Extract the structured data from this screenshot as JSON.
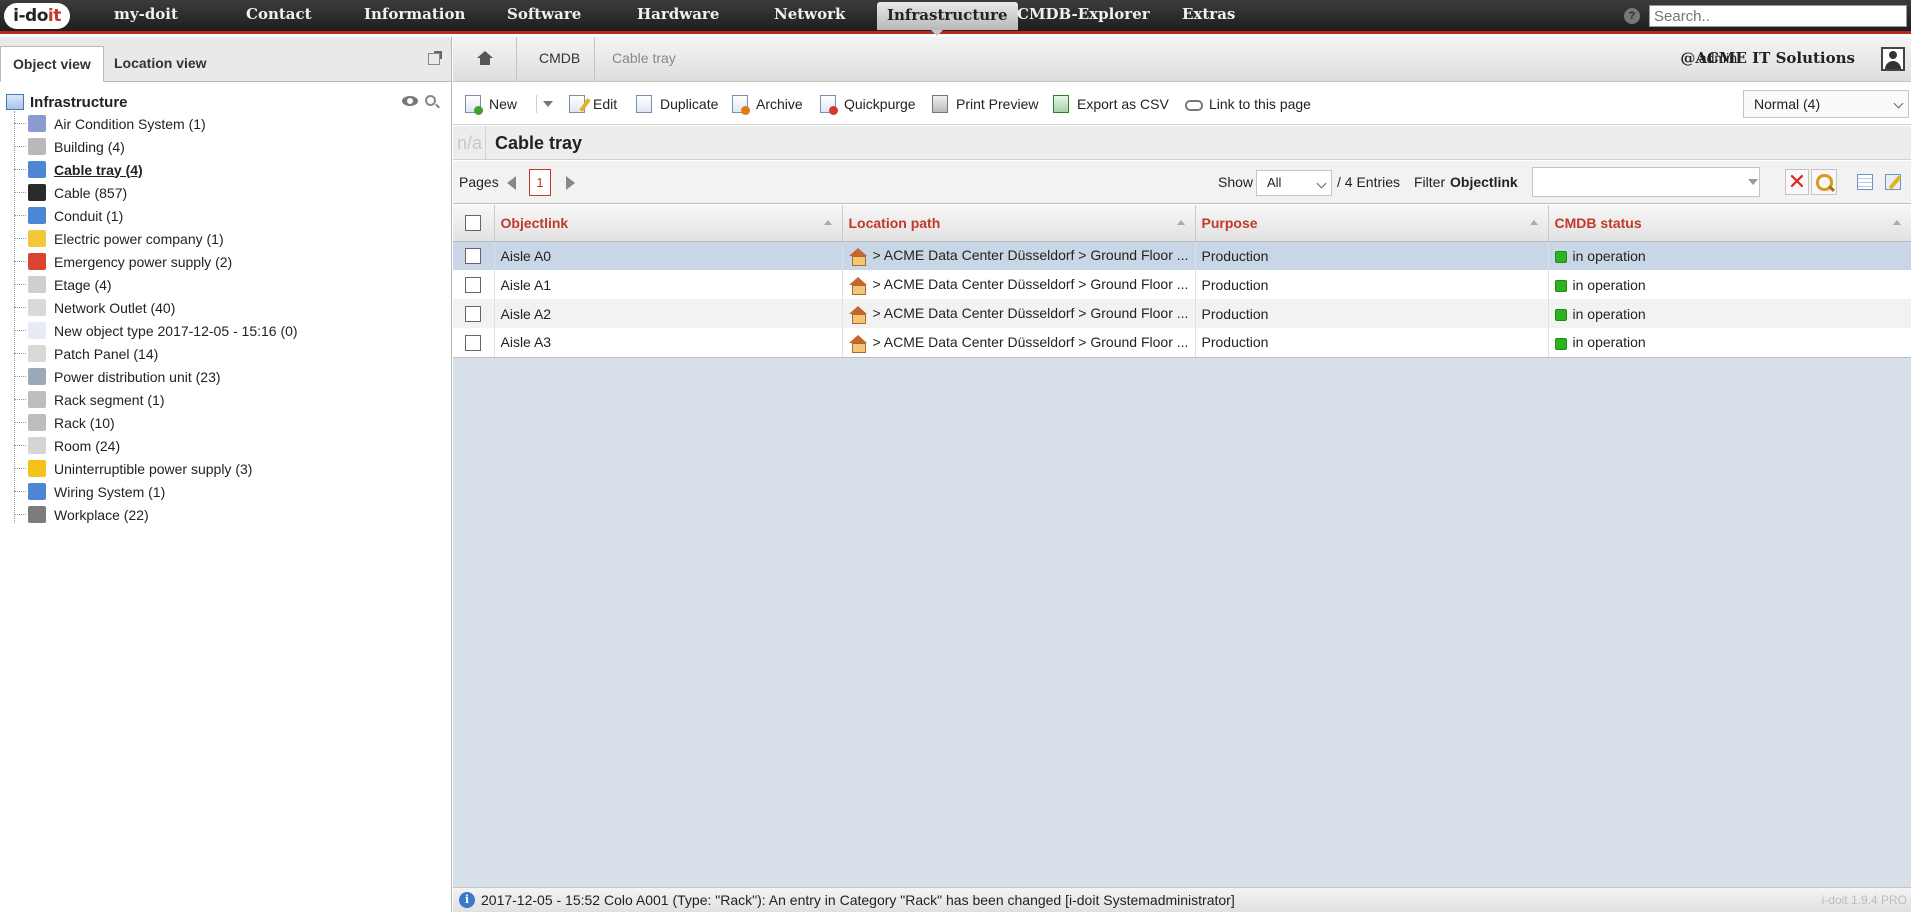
{
  "topnav": {
    "logo_main": "i-do",
    "logo_accent": "it",
    "items": [
      {
        "label": "my-doit",
        "name": "nav-my-doit"
      },
      {
        "label": "Contact",
        "name": "nav-contact"
      },
      {
        "label": "Information",
        "name": "nav-information"
      },
      {
        "label": "Software",
        "name": "nav-software"
      },
      {
        "label": "Hardware",
        "name": "nav-hardware"
      },
      {
        "label": "Network",
        "name": "nav-network"
      },
      {
        "label": "Infrastructure",
        "name": "nav-infrastructure"
      },
      {
        "label": "CMDB-Explorer",
        "name": "nav-cmdb-explorer"
      },
      {
        "label": "Extras",
        "name": "nav-extras"
      }
    ],
    "active": "Infrastructure",
    "help_icon": "?",
    "search_placeholder": "Search.."
  },
  "left_panel": {
    "tabs": [
      "Object view",
      "Location view"
    ],
    "active_tab": "Object view",
    "tree_root": "Infrastructure",
    "tree_items": [
      {
        "label": "Air Condition System (1)",
        "icon": "air-condition-icon",
        "color": "#8a9bd0"
      },
      {
        "label": "Building (4)",
        "icon": "building-icon",
        "color": "#b9b9b9"
      },
      {
        "label": "Cable tray (4)",
        "icon": "cable-tray-icon",
        "color": "#4e86d6",
        "selected": true
      },
      {
        "label": "Cable (857)",
        "icon": "cable-icon",
        "color": "#2a2a2a"
      },
      {
        "label": "Conduit (1)",
        "icon": "conduit-icon",
        "color": "#4e86d6"
      },
      {
        "label": "Electric power company (1)",
        "icon": "lightbulb-icon",
        "color": "#f2c93a"
      },
      {
        "label": "Emergency power supply (2)",
        "icon": "emergency-power-icon",
        "color": "#d9442f"
      },
      {
        "label": "Etage (4)",
        "icon": "floor-icon",
        "color": "#cfcfcf"
      },
      {
        "label": "Network Outlet (40)",
        "icon": "network-outlet-icon",
        "color": "#d9d9d9"
      },
      {
        "label": "New object type 2017-12-05 - 15:16 (0)",
        "icon": "document-icon",
        "color": "#e6ecf6"
      },
      {
        "label": "Patch Panel (14)",
        "icon": "patch-panel-icon",
        "color": "#d9d9d9"
      },
      {
        "label": "Power distribution unit (23)",
        "icon": "pdu-icon",
        "color": "#9ea9b8"
      },
      {
        "label": "Rack segment (1)",
        "icon": "rack-segment-icon",
        "color": "#bdbdbd"
      },
      {
        "label": "Rack (10)",
        "icon": "rack-icon",
        "color": "#bdbdbd"
      },
      {
        "label": "Room (24)",
        "icon": "room-icon",
        "color": "#d5d5d5"
      },
      {
        "label": "Uninterruptible power supply (3)",
        "icon": "lightning-icon",
        "color": "#f4c21a"
      },
      {
        "label": "Wiring System (1)",
        "icon": "omega-icon",
        "color": "#4e86d6"
      },
      {
        "label": "Workplace (22)",
        "icon": "workplace-icon",
        "color": "#7c7c7c"
      }
    ]
  },
  "breadcrumb": {
    "items": [
      "CMDB",
      "Cable tray"
    ],
    "user": "admin",
    "tenant": "@ACME IT Solutions"
  },
  "toolbar": {
    "new_label": "New",
    "edit_label": "Edit",
    "duplicate_label": "Duplicate",
    "archive_label": "Archive",
    "quickpurge_label": "Quickpurge",
    "print_label": "Print Preview",
    "export_label": "Export as CSV",
    "link_label": "Link to this page",
    "view_mode": "Normal (4)"
  },
  "title": {
    "na": "n/a",
    "text": "Cable tray"
  },
  "pager": {
    "pages_label": "Pages",
    "current_page": "1",
    "show_label": "Show",
    "show_value": "All",
    "entries": "/ 4 Entries",
    "filter_label": "Filter",
    "filter_field": "Objectlink",
    "clear_icon": "✕"
  },
  "table": {
    "columns": [
      "Objectlink",
      "Location path",
      "Purpose",
      "CMDB status"
    ],
    "rows": [
      {
        "object": "Aisle A0",
        "location": "> ACME Data Center Düsseldorf > Ground Floor ...",
        "purpose": "Production",
        "status": "in operation"
      },
      {
        "object": "Aisle A1",
        "location": "> ACME Data Center Düsseldorf > Ground Floor ...",
        "purpose": "Production",
        "status": "in operation"
      },
      {
        "object": "Aisle A2",
        "location": "> ACME Data Center Düsseldorf > Ground Floor ...",
        "purpose": "Production",
        "status": "in operation"
      },
      {
        "object": "Aisle A3",
        "location": "> ACME Data Center Düsseldorf > Ground Floor ...",
        "purpose": "Production",
        "status": "in operation"
      }
    ]
  },
  "statusbar": {
    "info_icon": "i",
    "message": "2017-12-05 - 15:52 Colo A001 (Type: \"Rack\"): An entry in Category \"Rack\" has been changed [i-doit Systemadministrator]",
    "version": "i-doit 1.9.4 PRO"
  },
  "colors": {
    "accent": "#c0392b",
    "selected_row": "#c9d6e6",
    "status_ok": "#2fb21f"
  }
}
